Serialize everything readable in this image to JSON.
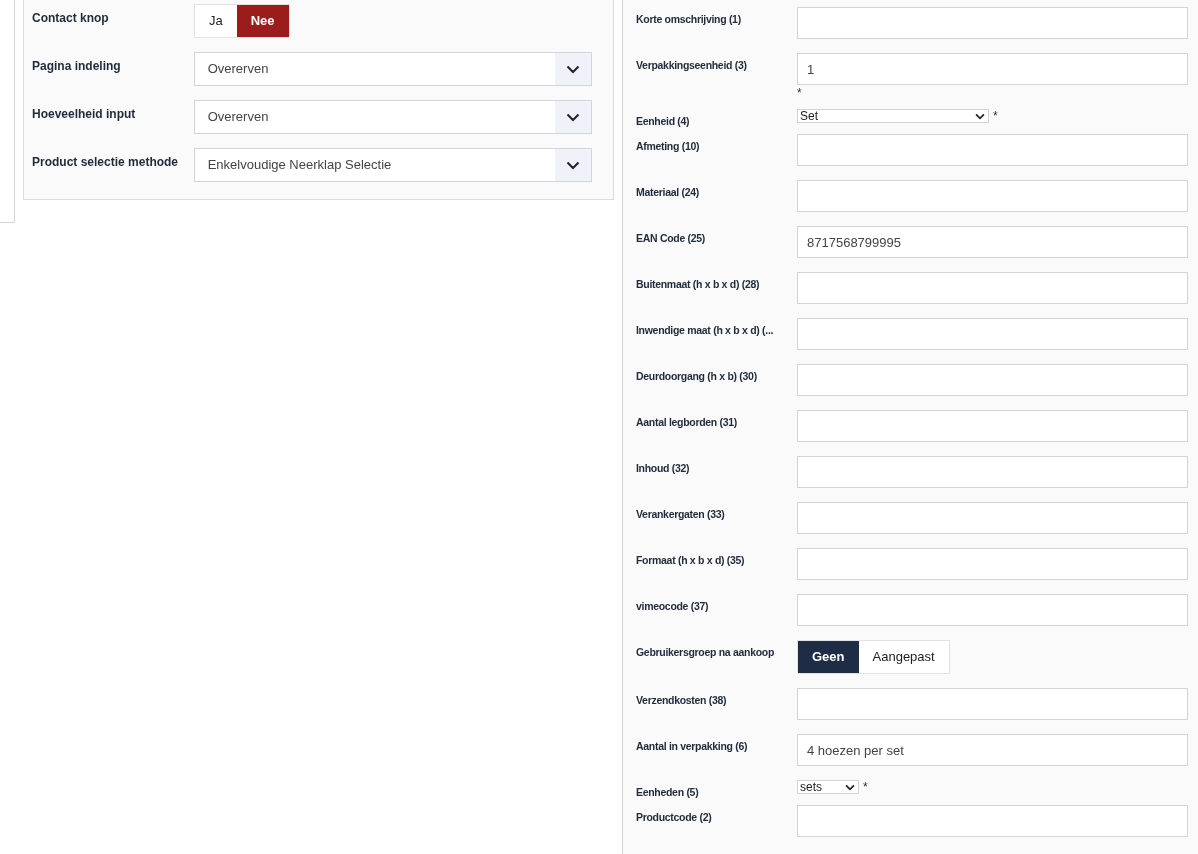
{
  "left_form": [
    {
      "kind": "toggle",
      "label": "Contact knop",
      "options": [
        {
          "label": "Ja",
          "selected": false
        },
        {
          "label": "Nee",
          "selected": true
        }
      ]
    },
    {
      "kind": "dropdown",
      "label": "Pagina indeling",
      "value": "Overerven"
    },
    {
      "kind": "dropdown",
      "label": "Hoeveelheid input",
      "value": "Overerven"
    },
    {
      "kind": "dropdown",
      "label": "Product selectie methode",
      "value": "Enkelvoudige Neerklap Selectie"
    }
  ],
  "right_form": [
    {
      "kind": "text",
      "label": "Korte omschrijving (1)"
    },
    {
      "kind": "text",
      "label": "Verpakkingseenheid (3)",
      "value": "1",
      "marker": "*"
    },
    {
      "kind": "select",
      "label": "Eenheid (4)",
      "value": "Set",
      "wide": true,
      "marker": "*"
    },
    {
      "kind": "text",
      "label": "Afmeting (10)"
    },
    {
      "kind": "text",
      "label": "Materiaal (24)"
    },
    {
      "kind": "text",
      "label": "EAN Code (25)",
      "value": "8717568799995"
    },
    {
      "kind": "text",
      "label": "Buitenmaat (h x b x d) (28)"
    },
    {
      "kind": "text",
      "label": "Inwendige maat (h x b x d) (..."
    },
    {
      "kind": "text",
      "label": "Deurdoorgang (h x b) (30)"
    },
    {
      "kind": "text",
      "label": "Aantal legborden (31)"
    },
    {
      "kind": "text",
      "label": "Inhoud (32)"
    },
    {
      "kind": "text",
      "label": "Verankergaten (33)"
    },
    {
      "kind": "text",
      "label": "Formaat (h x b x d) (35)"
    },
    {
      "kind": "text",
      "label": "vimeocode (37)"
    },
    {
      "kind": "toggle",
      "label": "Gebruikersgroep na aankoop",
      "options": [
        {
          "label": "Geen",
          "selected": true
        },
        {
          "label": "Aangepast",
          "selected": false
        }
      ]
    },
    {
      "kind": "text",
      "label": "Verzendkosten (38)"
    },
    {
      "kind": "text",
      "label": "Aantal in verpakking (6)",
      "value": "4 hoezen per set"
    },
    {
      "kind": "select",
      "label": "Eenheden (5)",
      "value": "sets",
      "wide": false,
      "marker": "*"
    },
    {
      "kind": "text",
      "label": "Productcode (2)"
    }
  ]
}
